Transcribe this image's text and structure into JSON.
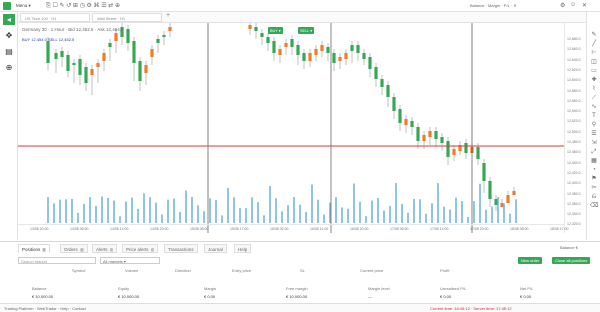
{
  "topbar": {
    "menu_label": "Menu ▾",
    "right_text": "Balance · Margin · P/L · ✕",
    "accent": "#35a855"
  },
  "tabs": [
    {
      "label": "US Tech 100 · H1"
    },
    {
      "label": "Wall Street · H1"
    }
  ],
  "leftbar": {
    "icons": [
      "plus-icon",
      "crosshair-icon",
      "chart-icon",
      "zoom-icon"
    ]
  },
  "chart": {
    "info_line": "Germany 30 · 1 Hour · Bid 12,452.5 · Ask 12,454.0",
    "info_line2": "BUY 12,454.0   SELL 12,452.5",
    "buy_label": "BUY ▾",
    "sell_label": "SELL ▾",
    "horizontal_line_color": "#e53935",
    "bull_color": "#35a855",
    "bear_color": "#f07c2a",
    "volume_color": "#8fc4e8"
  },
  "price_axis": [
    "12,680.0",
    "12,660.0",
    "12,640.0",
    "12,620.0",
    "12,600.0",
    "12,580.0",
    "12,560.0",
    "12,540.0",
    "12,520.0",
    "12,500.0",
    "12,480.0",
    "12,460.0",
    "12,440.0",
    "12,420.0",
    "12,400.0",
    "12,380.0",
    "12,360.0",
    "12,340.0",
    "12,320.0"
  ],
  "time_axis": [
    "13/08 20:00",
    "14/08 05:00",
    "14/08 14:00",
    "14/08 23:00",
    "15/08 08:00",
    "15/08 17:00",
    "16/08 02:00",
    "16/08 11:00",
    "16/08 20:00",
    "17/08 05:00",
    "17/08 14:00",
    "17/08 23:00",
    "18/08 08:00",
    "18/08 17:00"
  ],
  "bottom": {
    "tabs": [
      {
        "label": "Positions",
        "count": "0"
      },
      {
        "label": "Orders",
        "count": "0"
      },
      {
        "label": "Alerts",
        "count": "0"
      },
      {
        "label": "Price alerts",
        "count": "0"
      },
      {
        "label": "Transactions",
        "count": ""
      },
      {
        "label": "Journal",
        "count": ""
      },
      {
        "label": "Help",
        "count": ""
      }
    ],
    "filter_placeholder": "Search market",
    "filter2_label": "All markets ▾",
    "new_order_label": "New order",
    "close_all_label": "Close all positions",
    "columns": [
      "Symbol",
      "Volume",
      "Direction",
      "Entry price",
      "SL",
      "Current price",
      "Profit"
    ],
    "stats_labels": [
      "Balance",
      "Equity",
      "Margin",
      "Free margin",
      "Margin level",
      "Unrealised P/L",
      "Net P/L"
    ],
    "stats_values": [
      "€ 10,000.00",
      "€ 10,000.00",
      "€ 0.00",
      "€ 10,000.00",
      "—",
      "€ 0.00",
      "€ 0.00"
    ],
    "right_info": "Balance €"
  },
  "footer": {
    "left": "Trading Platform · WebTrader · Help · Contact",
    "right": "Current time: 18:45:12 · Server time: 17:45:12"
  }
}
